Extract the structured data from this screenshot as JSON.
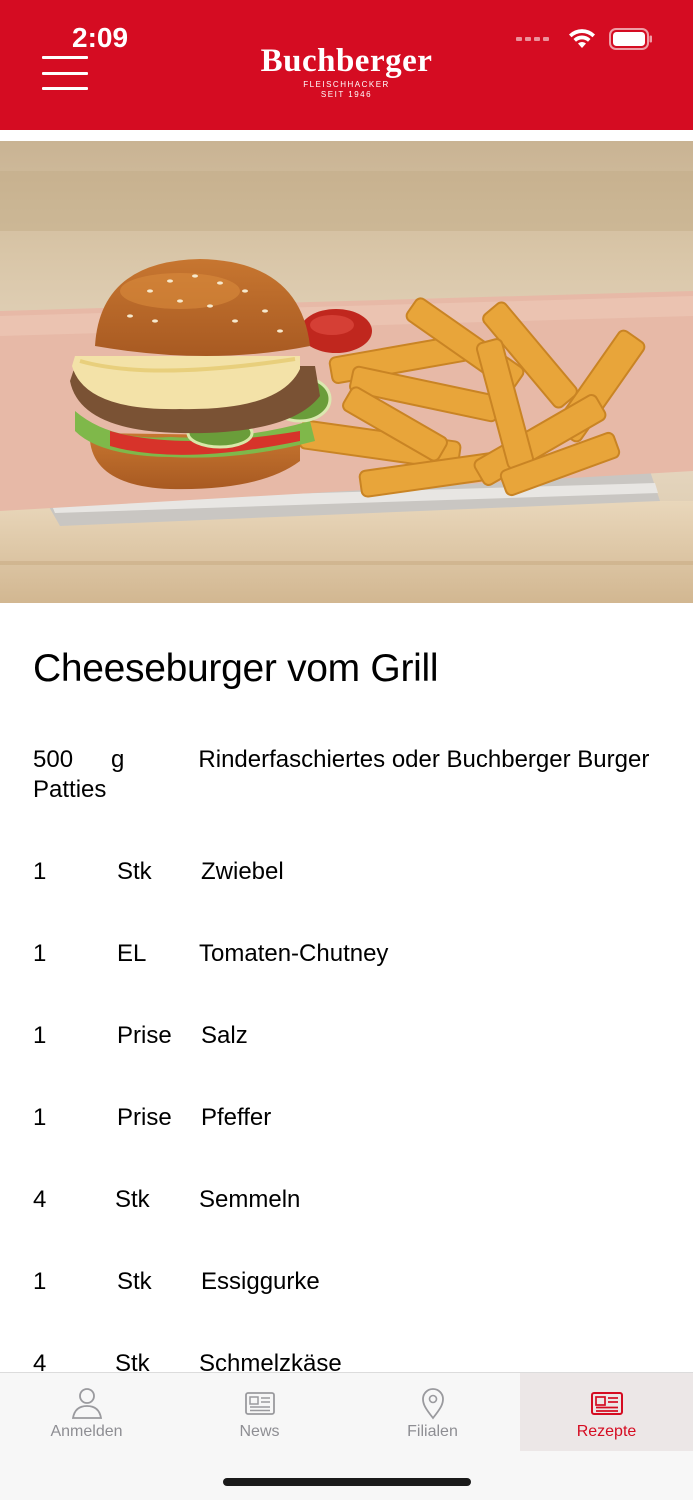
{
  "status_bar": {
    "time": "2:09"
  },
  "header": {
    "brand_name": "Buchberger",
    "brand_subtitle_1": "FLEISCHHACKER",
    "brand_subtitle_2": "SEIT 1946",
    "accent_color": "#d50c22"
  },
  "recipe": {
    "title": "Cheeseburger vom Grill",
    "first_ingredient": {
      "qty": "500",
      "unit": "g",
      "name": "Rinderfaschiertes oder Buchberger Burger Patties"
    },
    "ingredients": [
      {
        "qty": "1",
        "unit": "Stk",
        "name": "Zwiebel"
      },
      {
        "qty": "1",
        "unit": "EL",
        "name": "Tomaten-Chutney"
      },
      {
        "qty": "1",
        "unit": "Prise",
        "name": "Salz"
      },
      {
        "qty": "1",
        "unit": "Prise",
        "name": "Pfeffer"
      },
      {
        "qty": "4",
        "unit": "Stk",
        "name": "Semmeln"
      },
      {
        "qty": "1",
        "unit": "Stk",
        "name": "Essiggurke"
      },
      {
        "qty": "4",
        "unit": "Stk",
        "name": "Schmelzkäse"
      }
    ]
  },
  "tabbar": {
    "tabs": [
      {
        "label": "Anmelden",
        "icon": "person-icon"
      },
      {
        "label": "News",
        "icon": "newspaper-icon"
      },
      {
        "label": "Filialen",
        "icon": "location-pin-icon"
      },
      {
        "label": "Rezepte",
        "icon": "recipe-book-icon",
        "active": true
      }
    ]
  }
}
